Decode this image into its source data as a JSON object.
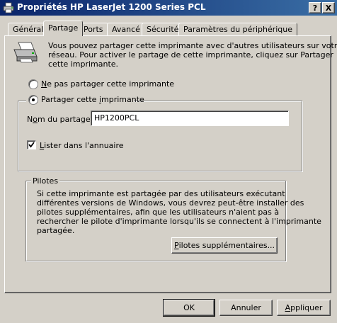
{
  "window": {
    "title": "Propriétés HP LaserJet 1200 Series PCL",
    "help_button": "?",
    "close_button": "X"
  },
  "tabs": [
    {
      "label": "Général"
    },
    {
      "label": "Partage",
      "active": true
    },
    {
      "label": "Ports"
    },
    {
      "label": "Avancé"
    },
    {
      "label": "Sécurité"
    },
    {
      "label": "Paramètres du périphérique"
    }
  ],
  "sharing": {
    "intro_lines": [
      "Vous pouvez partager cette imprimante avec d'autres utilisateurs sur votre",
      "réseau. Pour activer le partage de cette imprimante, cliquez sur Partager",
      "cette imprimante."
    ],
    "radio_not_share": {
      "prefix": "",
      "mnemonic": "N",
      "suffix": "e pas partager cette imprimante",
      "checked": false
    },
    "radio_share": {
      "prefix": "Partager cette ",
      "mnemonic": "i",
      "suffix": "mprimante",
      "checked": true
    },
    "share_name": {
      "label_prefix": "N",
      "label_mnemonic": "o",
      "label_suffix": "m du partage :",
      "value": "HP1200PCL"
    },
    "list_in_directory": {
      "mnemonic": "L",
      "suffix": "ister dans l'annuaire",
      "checked": true
    }
  },
  "drivers": {
    "legend": "Pilotes",
    "description_lines": [
      "Si cette imprimante est partagée par des utilisateurs exécutant",
      "différentes versions de Windows, vous devrez peut-être installer des",
      "pilotes supplémentaires, afin que les utilisateurs n'aient pas à",
      "rechercher le pilote d'imprimante lorsqu'ils se connectent à l'imprimante",
      "partagée."
    ],
    "button": {
      "mnemonic": "P",
      "suffix": "ilotes supplémentaires..."
    }
  },
  "footer": {
    "ok": "OK",
    "cancel": "Annuler",
    "apply": {
      "mnemonic": "A",
      "suffix": "ppliquer"
    }
  },
  "icons": {
    "title_icon": "printer-icon",
    "sharing_icon": "printer-icon"
  },
  "colors": {
    "title_bar_start": "#0a246a",
    "title_bar_end": "#3a6ea5",
    "face": "#d4d0c8"
  }
}
